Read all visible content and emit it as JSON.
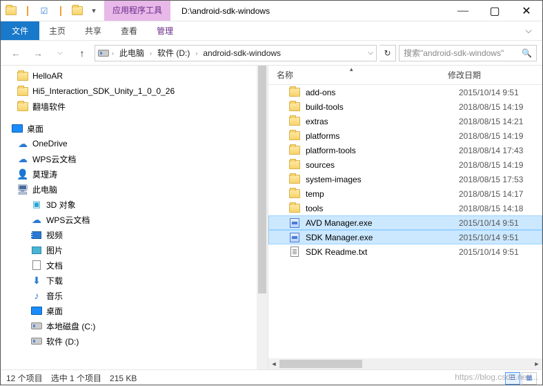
{
  "title": "D:\\android-sdk-windows",
  "context_tab_title": "应用程序工具",
  "context_tab_sub": "管理",
  "ribbon": {
    "file": "文件",
    "home": "主页",
    "share": "共享",
    "view": "查看"
  },
  "breadcrumb": {
    "segments": [
      "此电脑",
      "软件 (D:)",
      "android-sdk-windows"
    ]
  },
  "search_placeholder": "搜索\"android-sdk-windows\"",
  "tree": {
    "top_folders": [
      {
        "label": "HelloAR"
      },
      {
        "label": "Hi5_Interaction_SDK_Unity_1_0_0_26"
      },
      {
        "label": "翻墙软件"
      }
    ],
    "desktop_label": "桌面",
    "onedrive": "OneDrive",
    "wps": "WPS云文档",
    "user": "莫理涛",
    "pc": "此电脑",
    "pc_children": [
      {
        "label": "3D 对象",
        "icon": "obj3d"
      },
      {
        "label": "WPS云文档",
        "icon": "cloud"
      },
      {
        "label": "视频",
        "icon": "video"
      },
      {
        "label": "图片",
        "icon": "pic"
      },
      {
        "label": "文档",
        "icon": "doc"
      },
      {
        "label": "下载",
        "icon": "dl"
      },
      {
        "label": "音乐",
        "icon": "music"
      },
      {
        "label": "桌面",
        "icon": "desktop"
      },
      {
        "label": "本地磁盘 (C:)",
        "icon": "drive"
      },
      {
        "label": "软件 (D:)",
        "icon": "drive"
      }
    ]
  },
  "columns": {
    "name": "名称",
    "date": "修改日期"
  },
  "files": [
    {
      "name": "add-ons",
      "date": "2015/10/14 9:51",
      "type": "folder"
    },
    {
      "name": "build-tools",
      "date": "2018/08/15 14:19",
      "type": "folder"
    },
    {
      "name": "extras",
      "date": "2018/08/15 14:21",
      "type": "folder"
    },
    {
      "name": "platforms",
      "date": "2018/08/15 14:19",
      "type": "folder"
    },
    {
      "name": "platform-tools",
      "date": "2018/08/14 17:43",
      "type": "folder"
    },
    {
      "name": "sources",
      "date": "2018/08/15 14:19",
      "type": "folder"
    },
    {
      "name": "system-images",
      "date": "2018/08/15 17:53",
      "type": "folder"
    },
    {
      "name": "temp",
      "date": "2018/08/15 14:17",
      "type": "folder"
    },
    {
      "name": "tools",
      "date": "2018/08/15 14:18",
      "type": "folder"
    },
    {
      "name": "AVD Manager.exe",
      "date": "2015/10/14 9:51",
      "type": "exe",
      "selected": true
    },
    {
      "name": "SDK Manager.exe",
      "date": "2015/10/14 9:51",
      "type": "exe",
      "selected": true
    },
    {
      "name": "SDK Readme.txt",
      "date": "2015/10/14 9:51",
      "type": "txt"
    }
  ],
  "status": {
    "count": "12 个项目",
    "selection": "选中 1 个项目",
    "size": "215 KB"
  },
  "watermark": "https://blog.csdn.net/..."
}
